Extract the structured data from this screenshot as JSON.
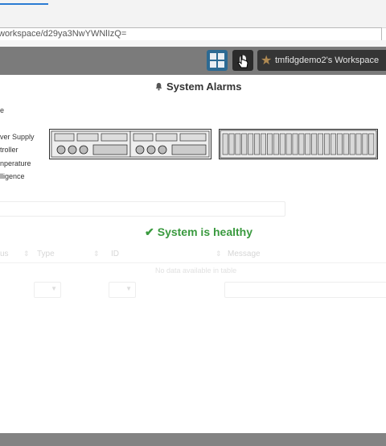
{
  "browser": {
    "address": "workspace/d29ya3NwYWNlIzQ="
  },
  "header": {
    "workspace_label": "tmfidgdemo2's Workspace",
    "icons": [
      "grid-icon",
      "bell-icon",
      "star-icon"
    ]
  },
  "alarms": {
    "title": "System Alarms",
    "left_items": [
      "e",
      "ver Supply",
      "troller",
      "nperature",
      "lligence"
    ]
  },
  "status": {
    "message": "System is healthy",
    "color": "#3a9a3f"
  },
  "table": {
    "columns": [
      "us",
      "Type",
      "ID",
      "Message"
    ],
    "empty_text": "No data available in table"
  }
}
